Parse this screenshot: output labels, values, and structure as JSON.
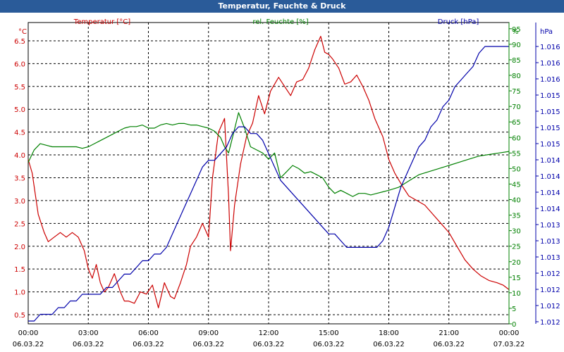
{
  "window_title": "Temperatur, Feuchte & Druck",
  "colors": {
    "temperature": "#cc0000",
    "humidity": "#008000",
    "pressure": "#0000aa",
    "titlebar": "#2a5b99",
    "grid": "#000000"
  },
  "chart_data": {
    "type": "line",
    "title": "Temperatur, Feuchte & Druck",
    "grid": true,
    "x_ticks": [
      {
        "time": "00:00",
        "date": "06.03.22",
        "hour": 0
      },
      {
        "time": "03:00",
        "date": "06.03.22",
        "hour": 3
      },
      {
        "time": "06:00",
        "date": "06.03.22",
        "hour": 6
      },
      {
        "time": "09:00",
        "date": "06.03.22",
        "hour": 9
      },
      {
        "time": "12:00",
        "date": "06.03.22",
        "hour": 12
      },
      {
        "time": "15:00",
        "date": "06.03.22",
        "hour": 15
      },
      {
        "time": "18:00",
        "date": "06.03.22",
        "hour": 18
      },
      {
        "time": "21:00",
        "date": "06.03.22",
        "hour": 21
      },
      {
        "time": "00:00",
        "date": "07.03.22",
        "hour": 24
      }
    ],
    "axes": {
      "left": {
        "unit": "°C",
        "name": "Temperatur [°C]",
        "min": 0.3,
        "max": 6.9,
        "ticks": [
          "0.5",
          "1.0",
          "1.5",
          "2.0",
          "2.5",
          "3.0",
          "3.5",
          "4.0",
          "4.5",
          "5.0",
          "5.5",
          "6.0",
          "6.5"
        ]
      },
      "humidity": {
        "unit": "%",
        "name": "rel. Feuchte [%]",
        "min": 0,
        "max": 97,
        "ticks": [
          "0",
          "5",
          "10",
          "15",
          "20",
          "25",
          "30",
          "35",
          "40",
          "45",
          "50",
          "55",
          "60",
          "65",
          "70",
          "75",
          "80",
          "85",
          "90",
          "95"
        ]
      },
      "pressure": {
        "unit": "hPa",
        "name": "Druck [hPa]",
        "ticks": [
          "1.012",
          "1.012",
          "1.012",
          "1.012",
          "1.013",
          "1.013",
          "1.013",
          "1.014",
          "1.014",
          "1.014",
          "1.014",
          "1.015",
          "1.015",
          "1.015",
          "1.015",
          "1.016",
          "1.016",
          "1.016"
        ]
      }
    },
    "series": [
      {
        "name": "Temperatur [°C]",
        "axis": "left",
        "color": "#cc0000",
        "x": [
          0,
          0.2,
          0.5,
          0.8,
          1.0,
          1.3,
          1.6,
          1.9,
          2.2,
          2.5,
          2.8,
          3.0,
          3.2,
          3.4,
          3.6,
          3.8,
          4.0,
          4.3,
          4.6,
          4.8,
          5.0,
          5.3,
          5.6,
          5.9,
          6.2,
          6.5,
          6.8,
          7.1,
          7.3,
          7.6,
          7.9,
          8.1,
          8.4,
          8.7,
          9.0,
          9.2,
          9.5,
          9.8,
          10.0,
          10.1,
          10.3,
          10.6,
          10.9,
          11.2,
          11.5,
          11.8,
          12.1,
          12.5,
          12.8,
          13.1,
          13.4,
          13.7,
          14.0,
          14.3,
          14.6,
          14.8,
          15.0,
          15.2,
          15.5,
          15.8,
          16.1,
          16.4,
          16.7,
          17.0,
          17.3,
          17.7,
          18.0,
          18.3,
          18.7,
          19.0,
          19.4,
          19.8,
          20.2,
          20.6,
          21.0,
          21.4,
          21.8,
          22.2,
          22.6,
          23.0,
          23.4,
          23.7,
          24.0
        ],
        "values": [
          3.9,
          3.6,
          2.7,
          2.3,
          2.1,
          2.2,
          2.3,
          2.2,
          2.3,
          2.2,
          1.9,
          1.5,
          1.3,
          1.6,
          1.2,
          1.0,
          1.1,
          1.4,
          1.0,
          0.8,
          0.8,
          0.75,
          1.0,
          0.95,
          1.15,
          0.65,
          1.2,
          0.9,
          0.85,
          1.2,
          1.6,
          2.0,
          2.2,
          2.5,
          2.2,
          3.5,
          4.5,
          4.8,
          3.1,
          1.9,
          2.9,
          3.8,
          4.4,
          4.7,
          5.3,
          4.9,
          5.4,
          5.7,
          5.5,
          5.3,
          5.6,
          5.65,
          5.9,
          6.3,
          6.6,
          6.25,
          6.2,
          6.1,
          5.9,
          5.55,
          5.6,
          5.75,
          5.5,
          5.2,
          4.8,
          4.4,
          3.9,
          3.6,
          3.3,
          3.1,
          3.0,
          2.9,
          2.7,
          2.5,
          2.3,
          2.0,
          1.7,
          1.5,
          1.35,
          1.25,
          1.2,
          1.15,
          1.05
        ]
      },
      {
        "name": "rel. Feuchte [%]",
        "axis": "humidity",
        "color": "#008000",
        "x": [
          0,
          0.3,
          0.6,
          0.9,
          1.2,
          1.5,
          1.8,
          2.1,
          2.4,
          2.7,
          3.0,
          3.3,
          3.6,
          3.9,
          4.2,
          4.5,
          4.8,
          5.1,
          5.4,
          5.7,
          6.0,
          6.3,
          6.6,
          6.9,
          7.2,
          7.5,
          7.8,
          8.1,
          8.4,
          8.7,
          9.0,
          9.3,
          9.6,
          9.8,
          10.0,
          10.2,
          10.5,
          10.8,
          11.1,
          11.4,
          11.7,
          12.0,
          12.3,
          12.6,
          12.9,
          13.2,
          13.5,
          13.8,
          14.1,
          14.4,
          14.7,
          15.0,
          15.3,
          15.6,
          15.9,
          16.2,
          16.5,
          16.8,
          17.1,
          17.4,
          17.7,
          18.0,
          18.5,
          19.0,
          19.5,
          20.0,
          20.5,
          21.0,
          21.5,
          22.0,
          22.5,
          23.0,
          23.5,
          24.0
        ],
        "values": [
          52,
          56,
          58,
          57.5,
          57,
          57,
          57,
          57,
          57,
          56.5,
          57,
          58,
          59,
          60,
          61,
          62,
          63,
          63.5,
          63.5,
          64,
          63,
          63,
          64,
          64.5,
          64,
          64.5,
          64.5,
          64,
          64,
          63.5,
          63,
          62,
          60,
          57,
          55,
          60,
          68,
          63,
          57,
          56,
          55,
          53,
          55,
          47,
          49,
          51,
          50,
          48.5,
          49,
          48,
          47,
          44,
          42,
          43,
          42,
          41,
          42,
          42,
          41.5,
          42,
          42.5,
          43,
          44,
          46,
          48,
          49,
          50,
          51,
          52,
          53,
          54,
          54.5,
          55,
          55.5
        ]
      },
      {
        "name": "Druck [hPa]",
        "axis": "pixel",
        "color": "#0000aa",
        "x": [
          0,
          0.3,
          0.6,
          0.9,
          1.2,
          1.5,
          1.8,
          2.1,
          2.4,
          2.7,
          3.0,
          3.3,
          3.6,
          3.9,
          4.2,
          4.5,
          4.8,
          5.1,
          5.4,
          5.7,
          6.0,
          6.3,
          6.6,
          6.9,
          7.2,
          7.5,
          7.8,
          8.1,
          8.4,
          8.7,
          9.0,
          9.3,
          9.6,
          9.9,
          10.2,
          10.5,
          10.8,
          11.1,
          11.4,
          11.7,
          12.0,
          12.3,
          12.6,
          12.9,
          13.2,
          13.5,
          13.8,
          14.1,
          14.4,
          14.7,
          15.0,
          15.3,
          15.6,
          15.9,
          16.2,
          16.5,
          16.8,
          17.1,
          17.4,
          17.7,
          18.0,
          18.3,
          18.6,
          18.9,
          19.2,
          19.5,
          19.8,
          20.1,
          20.4,
          20.7,
          21.0,
          21.3,
          21.6,
          21.9,
          22.2,
          22.5,
          22.8,
          23.1,
          23.4,
          23.7,
          24.0
        ],
        "values": [
          1.012,
          1.012,
          1.0121,
          1.0121,
          1.0121,
          1.0122,
          1.0122,
          1.0123,
          1.0123,
          1.0124,
          1.0124,
          1.0124,
          1.0124,
          1.0125,
          1.0125,
          1.0126,
          1.0127,
          1.0127,
          1.0128,
          1.0129,
          1.0129,
          1.013,
          1.013,
          1.0131,
          1.0133,
          1.0135,
          1.0137,
          1.0139,
          1.0141,
          1.0143,
          1.0144,
          1.0144,
          1.0145,
          1.0146,
          1.0148,
          1.0149,
          1.0149,
          1.0148,
          1.0148,
          1.0147,
          1.0145,
          1.0143,
          1.0141,
          1.014,
          1.0139,
          1.0138,
          1.0137,
          1.0136,
          1.0135,
          1.0134,
          1.0133,
          1.0133,
          1.0132,
          1.0131,
          1.0131,
          1.0131,
          1.0131,
          1.0131,
          1.0131,
          1.0132,
          1.0134,
          1.0137,
          1.014,
          1.0142,
          1.0144,
          1.0146,
          1.0147,
          1.0149,
          1.015,
          1.0152,
          1.0153,
          1.0155,
          1.0156,
          1.0157,
          1.0158,
          1.016,
          1.0161,
          1.0161,
          1.0161,
          1.0161,
          1.0161
        ]
      }
    ]
  }
}
